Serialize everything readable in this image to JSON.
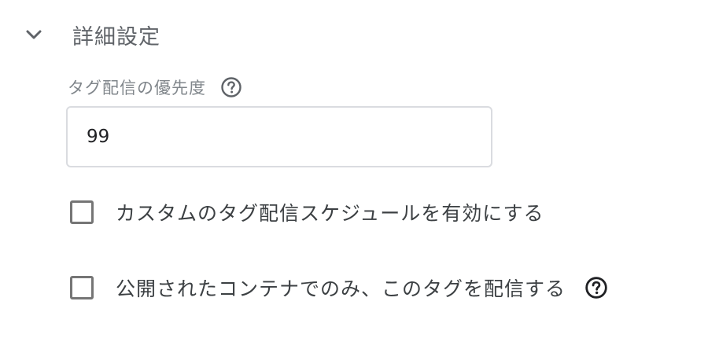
{
  "section": {
    "title": "詳細設定",
    "expanded": true,
    "icon": "chevron-down-icon"
  },
  "priority": {
    "label": "タグ配信の優先度",
    "value": "99",
    "help_icon": "help-circle-icon"
  },
  "options": [
    {
      "label": "カスタムのタグ配信スケジュールを有効にする",
      "checked": false
    },
    {
      "label": "公開されたコンテナでのみ、このタグを配信する",
      "checked": false,
      "help_icon": "help-circle-icon"
    }
  ],
  "colors": {
    "checkbox_border": "#757575",
    "input_border": "#dadce0",
    "label_gray": "#80868b",
    "icon_dark": "#3c4043"
  }
}
